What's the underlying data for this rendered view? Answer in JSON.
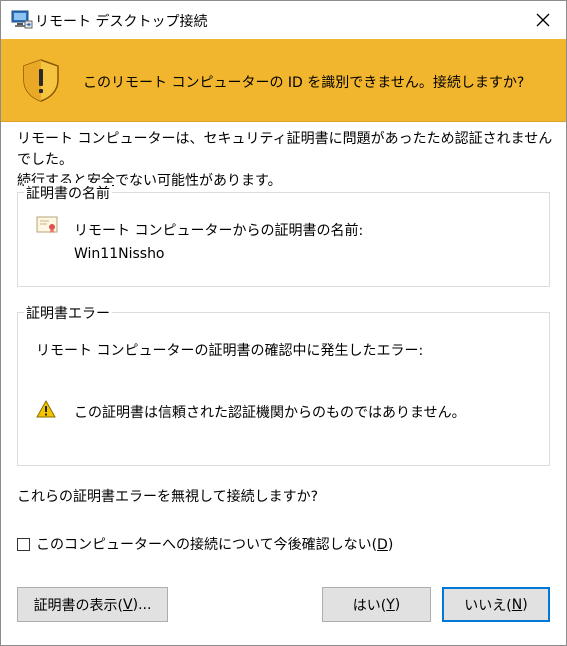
{
  "window": {
    "title": "リモート デスクトップ接続",
    "close_icon": "close-icon"
  },
  "banner": {
    "icon": "warning-shield-icon",
    "text": "このリモート コンピューターの ID を識別できません。接続しますか?"
  },
  "message": {
    "line1": "リモート コンピューターは、セキュリティ証明書に問題があったため認証されませんでした。",
    "line2": "続行すると安全でない可能性があります。"
  },
  "cert_name_group": {
    "label": "証明書の名前",
    "icon": "certificate-icon",
    "line1": "リモート コンピューターからの証明書の名前:",
    "line2": "Win11Nissho"
  },
  "cert_error_group": {
    "label": "証明書エラー",
    "line1": "リモート コンピューターの証明書の確認中に発生したエラー:",
    "icon": "warning-icon",
    "line2": "この証明書は信頼された認証機関からのものではありません。"
  },
  "question": "これらの証明書エラーを無視して接続しますか?",
  "checkbox": {
    "label_prefix": "このコンピューターへの接続について今後確認しない(",
    "accel": "D",
    "label_suffix": ")",
    "checked": false
  },
  "buttons": {
    "view_cert": {
      "prefix": "証明書の表示(",
      "accel": "V",
      "suffix": ")..."
    },
    "yes": {
      "prefix": "はい(",
      "accel": "Y",
      "suffix": ")"
    },
    "no": {
      "prefix": "いいえ(",
      "accel": "N",
      "suffix": ")"
    }
  },
  "colors": {
    "banner": "#f2b62e",
    "default_button_border": "#0078d7"
  }
}
